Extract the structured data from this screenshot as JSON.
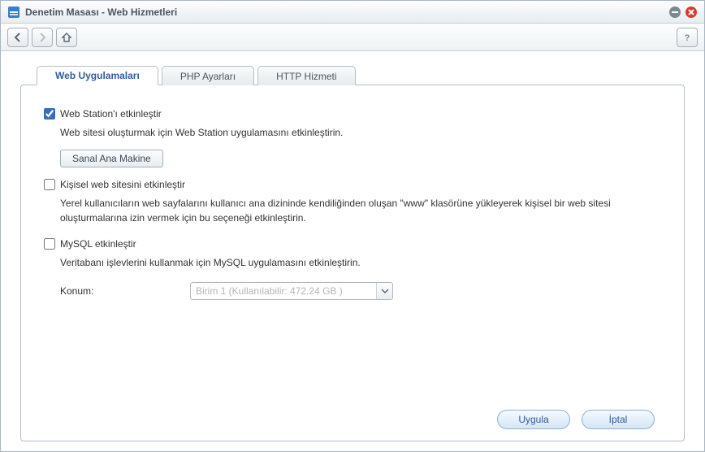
{
  "window": {
    "title": "Denetim Masası - Web Hizmetleri"
  },
  "tabs": {
    "web_apps": "Web Uygulamaları",
    "php_settings": "PHP Ayarları",
    "http_service": "HTTP Hizmeti"
  },
  "opts": {
    "web_station": {
      "label": "Web Station'ı etkinleştir",
      "checked": true,
      "desc": "Web sitesi oluşturmak için Web Station uygulamasını etkinleştirin.",
      "virtual_host_btn": "Sanal Ana Makine"
    },
    "personal_web": {
      "label": "Kişisel web sitesini etkinleştir",
      "checked": false,
      "desc": "Yerel kullanıcıların web sayfalarını kullanıcı ana dizininde kendiliğinden oluşan \"www\" klasörüne yükleyerek kişisel bir web sitesi oluşturmalarına izin vermek için bu seçeneği etkinleştirin."
    },
    "mysql": {
      "label": "MySQL etkinleştir",
      "checked": false,
      "desc": "Veritabanı işlevlerini kullanmak için MySQL uygulamasını etkinleştirin.",
      "location_label": "Konum:",
      "location_value": "Birim 1 (Kullanılabilir: 472.24 GB )"
    }
  },
  "footer": {
    "apply": "Uygula",
    "cancel": "İptal"
  }
}
